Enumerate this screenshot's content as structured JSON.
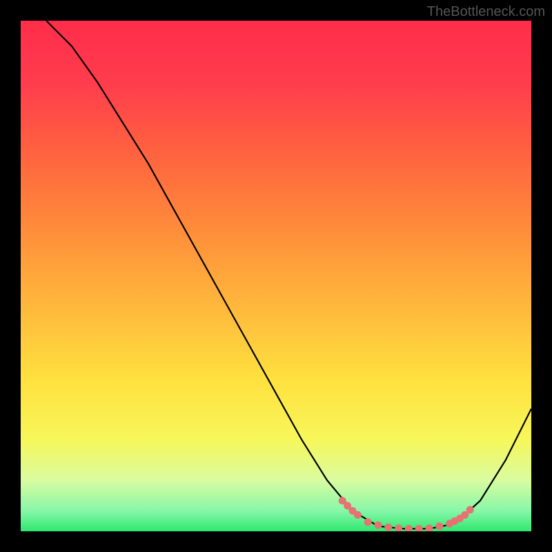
{
  "watermark": "TheBottleneck.com",
  "chart_data": {
    "type": "line",
    "title": "",
    "xlabel": "",
    "ylabel": "",
    "xlim": [
      0,
      100
    ],
    "ylim": [
      0,
      100
    ],
    "gradient_stops": [
      {
        "offset": 0,
        "color": "#ff2d4a"
      },
      {
        "offset": 12,
        "color": "#ff3c4d"
      },
      {
        "offset": 25,
        "color": "#ff6040"
      },
      {
        "offset": 40,
        "color": "#ff8a3a"
      },
      {
        "offset": 55,
        "color": "#ffb53c"
      },
      {
        "offset": 70,
        "color": "#ffe03e"
      },
      {
        "offset": 82,
        "color": "#f7f75a"
      },
      {
        "offset": 90,
        "color": "#d9fca0"
      },
      {
        "offset": 96,
        "color": "#87f7a8"
      },
      {
        "offset": 100,
        "color": "#2ee86f"
      }
    ],
    "series": [
      {
        "name": "curve",
        "color": "#000000",
        "points": [
          {
            "x": 5,
            "y": 100
          },
          {
            "x": 10,
            "y": 95
          },
          {
            "x": 15,
            "y": 88
          },
          {
            "x": 20,
            "y": 80
          },
          {
            "x": 25,
            "y": 72
          },
          {
            "x": 30,
            "y": 63
          },
          {
            "x": 35,
            "y": 54
          },
          {
            "x": 40,
            "y": 45
          },
          {
            "x": 45,
            "y": 36
          },
          {
            "x": 50,
            "y": 27
          },
          {
            "x": 55,
            "y": 18
          },
          {
            "x": 60,
            "y": 10
          },
          {
            "x": 65,
            "y": 4
          },
          {
            "x": 70,
            "y": 1
          },
          {
            "x": 75,
            "y": 0.5
          },
          {
            "x": 80,
            "y": 0.5
          },
          {
            "x": 85,
            "y": 1.5
          },
          {
            "x": 90,
            "y": 6
          },
          {
            "x": 95,
            "y": 14
          },
          {
            "x": 100,
            "y": 24
          }
        ]
      }
    ],
    "highlight_dots": {
      "color": "#e57373",
      "points": [
        {
          "x": 63,
          "y": 6
        },
        {
          "x": 64,
          "y": 5
        },
        {
          "x": 65,
          "y": 4
        },
        {
          "x": 66,
          "y": 3.2
        },
        {
          "x": 68,
          "y": 1.8
        },
        {
          "x": 70,
          "y": 1.2
        },
        {
          "x": 72,
          "y": 0.8
        },
        {
          "x": 74,
          "y": 0.6
        },
        {
          "x": 76,
          "y": 0.5
        },
        {
          "x": 78,
          "y": 0.5
        },
        {
          "x": 80,
          "y": 0.6
        },
        {
          "x": 82,
          "y": 1
        },
        {
          "x": 84,
          "y": 1.5
        },
        {
          "x": 85,
          "y": 2
        },
        {
          "x": 86,
          "y": 2.5
        },
        {
          "x": 87,
          "y": 3.2
        },
        {
          "x": 88,
          "y": 4.2
        }
      ]
    }
  }
}
